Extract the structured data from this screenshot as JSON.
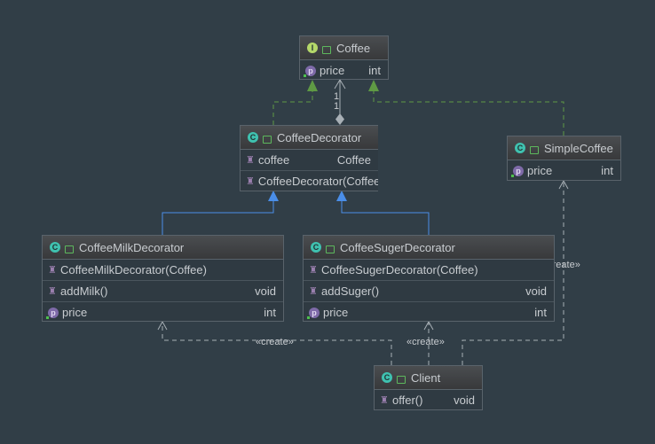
{
  "classes": {
    "coffee": {
      "name": "Coffee",
      "kind": "interface",
      "fields": [
        {
          "name": "price",
          "type": "int"
        }
      ]
    },
    "decorator": {
      "name": "CoffeeDecorator",
      "kind": "class",
      "fields": [
        {
          "name": "coffee",
          "type": "Coffee"
        }
      ],
      "methods": [
        {
          "name": "CoffeeDecorator(Coffee)"
        }
      ]
    },
    "simple": {
      "name": "SimpleCoffee",
      "kind": "class",
      "fields": [
        {
          "name": "price",
          "type": "int"
        }
      ]
    },
    "milk": {
      "name": "CoffeeMilkDecorator",
      "kind": "class",
      "methods": [
        {
          "name": "CoffeeMilkDecorator(Coffee)"
        },
        {
          "name": "addMilk()",
          "type": "void"
        }
      ],
      "fields": [
        {
          "name": "price",
          "type": "int"
        }
      ]
    },
    "suger": {
      "name": "CoffeeSugerDecorator",
      "kind": "class",
      "methods": [
        {
          "name": "CoffeeSugerDecorator(Coffee)"
        },
        {
          "name": "addSuger()",
          "type": "void"
        }
      ],
      "fields": [
        {
          "name": "price",
          "type": "int"
        }
      ]
    },
    "client": {
      "name": "Client",
      "kind": "class",
      "methods": [
        {
          "name": "offer()",
          "type": "void"
        }
      ]
    }
  },
  "edges": {
    "multiplicity_top": "1",
    "multiplicity_bottom": "1",
    "create1": "«create»",
    "create2": "«create»",
    "create3": "«create»"
  },
  "colors": {
    "implements": "#5f9a44",
    "extends": "#4a8ee8",
    "dependency": "#a8b0b6"
  }
}
